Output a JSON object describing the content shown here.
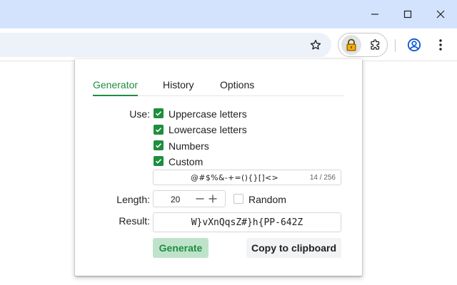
{
  "colors": {
    "accent": "#1e8e3e",
    "titlebar": "#d3e3fd",
    "omnibox": "#edf2fa",
    "profile": "#0b57d0",
    "lock_ext": "#f9ab00"
  },
  "window_controls": {
    "icons": [
      "minimize-icon",
      "maximize-icon",
      "close-icon"
    ]
  },
  "toolbar": {
    "icons": [
      "star-icon",
      "lock-extension-icon",
      "puzzle-icon",
      "profile-icon",
      "more-vert-icon"
    ]
  },
  "popup": {
    "tabs": [
      {
        "label": "Generator",
        "active": true
      },
      {
        "label": "History",
        "active": false
      },
      {
        "label": "Options",
        "active": false
      }
    ],
    "use_label": "Use:",
    "charsets": [
      {
        "label": "Uppercase letters",
        "checked": true
      },
      {
        "label": "Lowercase letters",
        "checked": true
      },
      {
        "label": "Numbers",
        "checked": true
      },
      {
        "label": "Custom",
        "checked": true
      }
    ],
    "custom_value": "@#$%&-+=(){}[]<>",
    "custom_counter": "14 / 256",
    "length_label": "Length:",
    "length_value": "20",
    "random_label": "Random",
    "random_checked": false,
    "result_label": "Result:",
    "result_value": "W}vXnQqsZ#}h{PP-642Z",
    "generate_label": "Generate",
    "copy_label": "Copy to clipboard"
  }
}
